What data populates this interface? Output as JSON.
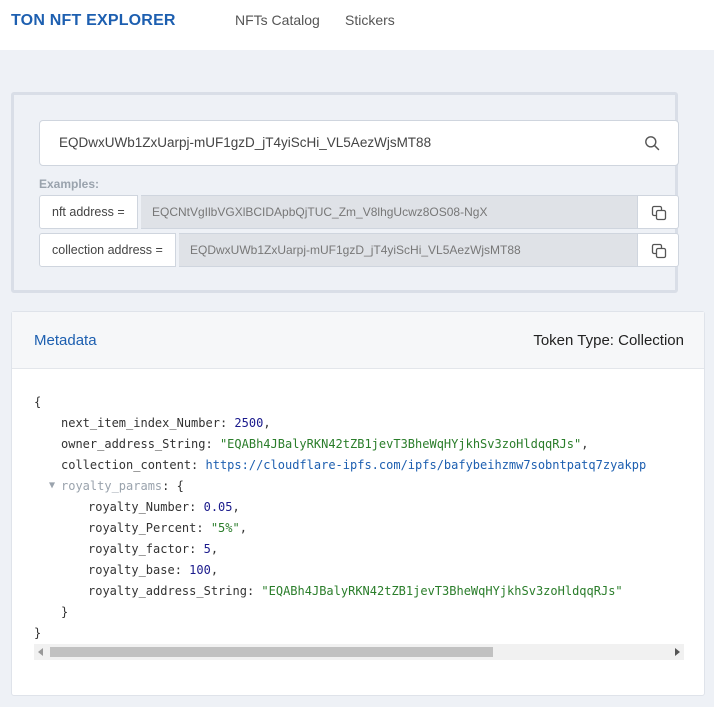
{
  "header": {
    "logo": "TON NFT EXPLORER",
    "nav": [
      "NFTs Catalog",
      "Stickers"
    ]
  },
  "search": {
    "value": "EQDwxUWb1ZxUarpj-mUF1gzD_jT4yiScHi_VL5AezWjsMT88",
    "icon": "search-icon"
  },
  "examples": {
    "label": "Examples:",
    "rows": [
      {
        "tag": "nft address =",
        "value": "EQCNtVgIlbVGXlBCIDApbQjTUC_Zm_V8lhgUcwz8OS08-NgX"
      },
      {
        "tag": "collection address =",
        "value": "EQDwxUWb1ZxUarpj-mUF1gzD_jT4yiScHi_VL5AezWjsMT88"
      }
    ]
  },
  "metadata": {
    "title": "Metadata",
    "token_type": "Token Type: Collection",
    "json": {
      "open_brace": "{",
      "close_brace": "}",
      "next_item_index_key": "next_item_index_Number",
      "next_item_index_val": "2500",
      "owner_address_key": "owner_address_String",
      "owner_address_val": "\"EQABh4JBalyRKN42tZB1jevT3BheWqHYjkhSv3zoHldqqRJs\"",
      "collection_content_key": "collection_content",
      "collection_content_val": "https://cloudflare-ipfs.com/ipfs/bafybeihzmw7sobntpatq7zyakpp",
      "royalty_params_key": "royalty_params",
      "royalty_number_key": "royalty_Number",
      "royalty_number_val": "0.05",
      "royalty_percent_key": "royalty_Percent",
      "royalty_percent_val": "\"5%\"",
      "royalty_factor_key": "royalty_factor",
      "royalty_factor_val": "5",
      "royalty_base_key": "royalty_base",
      "royalty_base_val": "100",
      "royalty_address_key": "royalty_address_String",
      "royalty_address_val": "\"EQABh4JBalyRKN42tZB1jevT3BheWqHYjkhSv3zoHldqqRJs\""
    }
  },
  "colors": {
    "brand": "#1d5fb0",
    "string": "#2a7d2a",
    "number": "#1a1a8c"
  }
}
